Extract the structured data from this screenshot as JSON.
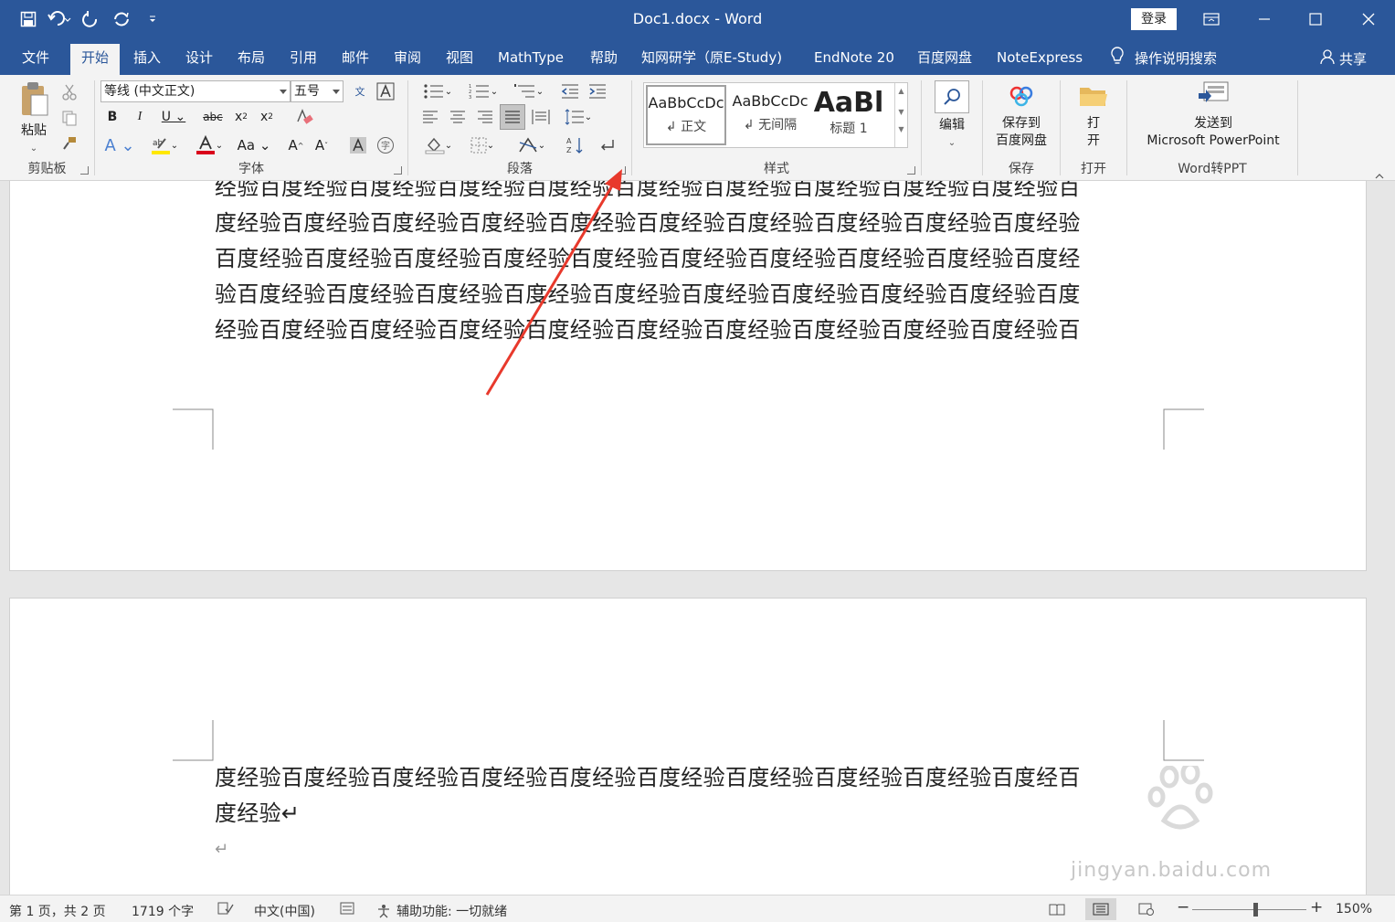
{
  "window": {
    "title": "Doc1.docx - Word",
    "login_label": "登录"
  },
  "tabs": [
    {
      "label": "文件"
    },
    {
      "label": "开始"
    },
    {
      "label": "插入"
    },
    {
      "label": "设计"
    },
    {
      "label": "布局"
    },
    {
      "label": "引用"
    },
    {
      "label": "邮件"
    },
    {
      "label": "审阅"
    },
    {
      "label": "视图"
    },
    {
      "label": "MathType"
    },
    {
      "label": "帮助"
    },
    {
      "label": "知网研学（原E-Study)"
    },
    {
      "label": "EndNote 20"
    },
    {
      "label": "百度网盘"
    },
    {
      "label": "NoteExpress"
    }
  ],
  "tell_me": "操作说明搜索",
  "share_label": "共享",
  "ribbon": {
    "clipboard": {
      "paste_label": "粘贴",
      "group_label": "剪贴板"
    },
    "font": {
      "font_name": "等线 (中文正文)",
      "font_size": "五号",
      "group_label": "字体"
    },
    "paragraph": {
      "group_label": "段落"
    },
    "styles": {
      "group_label": "样式",
      "items": [
        {
          "preview": "AaBbCcDc",
          "name": "↲ 正文"
        },
        {
          "preview": "AaBbCcDc",
          "name": "↲ 无间隔"
        },
        {
          "preview": "AaBl",
          "name": "标题 1"
        }
      ]
    },
    "editing": {
      "label": "编辑"
    },
    "save": {
      "line1": "保存到",
      "line2": "百度网盘",
      "group_label": "保存"
    },
    "open": {
      "line1": "打",
      "line2": "开",
      "group_label": "打开"
    },
    "wordppt": {
      "line1": "发送到",
      "line2": "Microsoft PowerPoint",
      "group_label": "Word转PPT"
    }
  },
  "document": {
    "page1_lines": [
      "经验百度经验百度经验百度经验百度经验百度经验百度经验百度经验百度经验百度经验百",
      "度经验百度经验百度经验百度经验百度经验百度经验百度经验百度经验百度经验百度经验",
      "百度经验百度经验百度经验百度经验百度经验百度经验百度经验百度经验百度经验百度经",
      "验百度经验百度经验百度经验百度经验百度经验百度经验百度经验百度经验百度经验百度",
      "经验百度经验百度经验百度经验百度经验百度经验百度经验百度经验百度经验百度经验百"
    ],
    "page2_lines": [
      "度经验百度经验百度经验百度经验百度经验百度经验百度经验百度经验百度经验百度经百",
      "度经验↵"
    ],
    "empty_para": "↵"
  },
  "watermark": {
    "url": "jingyan.baidu.com"
  },
  "status": {
    "page": "第 1 页，共 2 页",
    "words": "1719 个字",
    "language": "中文(中国)",
    "accessibility": "辅助功能: 一切就绪",
    "zoom": "150%"
  },
  "colors": {
    "accent": "#2b579a",
    "annotation_arrow": "#e8392c"
  }
}
